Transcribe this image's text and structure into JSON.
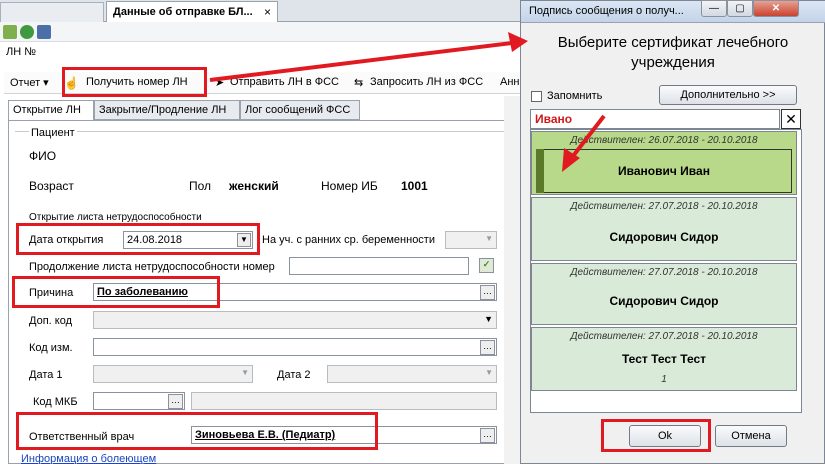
{
  "tabs": {
    "active_title": "Данные об отправке БЛ...",
    "close": "×"
  },
  "ln_label": "ЛН №",
  "menu": {
    "report": "Отчет",
    "get_number": "Получить номер ЛН",
    "send_fss": "Отправить ЛН в ФСС",
    "request_fss": "Запросить ЛН из ФСС",
    "more": "Анн"
  },
  "subtabs": [
    "Открытие ЛН",
    "Закрытие/Продление ЛН",
    "Лог сообщений ФСС"
  ],
  "patient": {
    "group": "Пациент",
    "fio": "ФИО",
    "age": "Возраст",
    "sex_label": "Пол",
    "sex_value": "женский",
    "ib_label": "Номер ИБ",
    "ib_value": "1001"
  },
  "opening": {
    "group": "Открытие листа нетрудоспособности",
    "date_label": "Дата открытия",
    "date_value": "24.08.2018",
    "early_preg": "На уч. с ранних ср. беременности",
    "continuation": "Продолжение листа нетрудоспособности номер",
    "reason_label": "Причина",
    "reason_value": "По заболеванию",
    "dop_code": "Доп. код",
    "code_change": "Код изм.",
    "date1": "Дата 1",
    "date2": "Дата 2",
    "mkb": "Код МКБ",
    "doctor_label": "Ответственный врач",
    "doctor_value": "Зиновьева Е.В. (Педиатр)",
    "info_link": "Информация о болеющем"
  },
  "dialog": {
    "title": "Подпись сообщения о получ...",
    "heading": "Выберите сертификат лечебного учреждения",
    "remember": "Запомнить",
    "more_btn": "Дополнительно >>",
    "search_value": "Ивано",
    "clear": "✕",
    "certs": [
      {
        "valid": "Действителен: 26.07.2018 - 20.10.2018",
        "name": "Иванович Иван",
        "extra": ""
      },
      {
        "valid": "Действителен: 27.07.2018 - 20.10.2018",
        "name": "Сидорович Сидор",
        "extra": ""
      },
      {
        "valid": "Действителен: 27.07.2018 - 20.10.2018",
        "name": "Сидорович Сидор",
        "extra": ""
      },
      {
        "valid": "Действителен: 27.07.2018 - 20.10.2018",
        "name": "Тест Тест Тест",
        "extra": "1"
      }
    ],
    "ok": "Ok",
    "cancel": "Отмена"
  },
  "colors": {
    "highlight": "#e11a22",
    "selected_cert": "#b9d98a",
    "cert_bg": "#d9ead8"
  }
}
